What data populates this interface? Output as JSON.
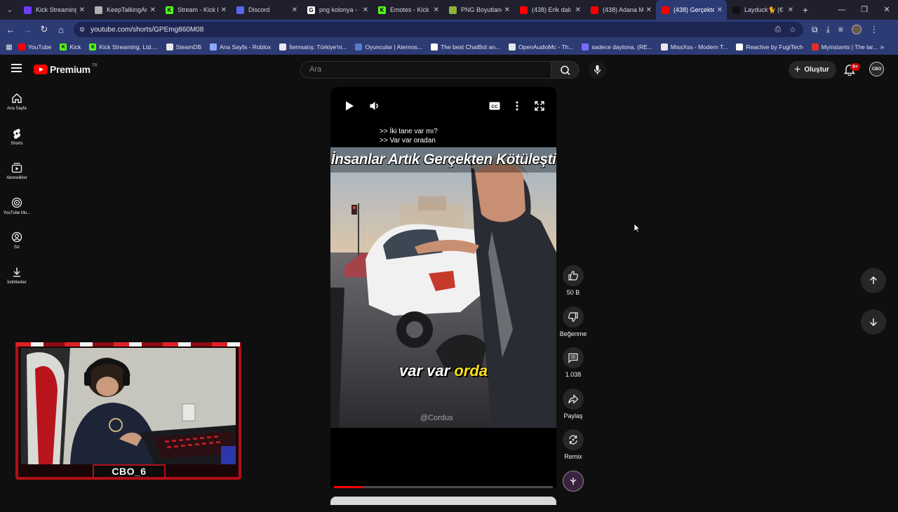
{
  "browser": {
    "tabs": [
      {
        "title": "Kick Streaming",
        "fav": "#6d3cf4",
        "fav_char": ""
      },
      {
        "title": "KeepTalkingAn",
        "fav": "#b0b0b0",
        "fav_char": ""
      },
      {
        "title": "Stream - Kick D",
        "fav": "#53fc18",
        "fav_char": "K"
      },
      {
        "title": "Discord",
        "fav": "#5865f2",
        "fav_char": ""
      },
      {
        "title": "png kolonya -",
        "fav": "#ffffff",
        "fav_char": "G"
      },
      {
        "title": "Emotes - Kick D",
        "fav": "#53fc18",
        "fav_char": "K"
      },
      {
        "title": "PNG Boyutland",
        "fav": "#8fb33a",
        "fav_char": ""
      },
      {
        "title": "(438) Erik dalı",
        "fav": "#ff0000",
        "fav_char": ""
      },
      {
        "title": "(438) Adana M",
        "fav": "#ff0000",
        "fav_char": ""
      },
      {
        "title": "(438) Gerçekte",
        "fav": "#ff0000",
        "fav_char": "",
        "active": true
      },
      {
        "title": "Layduck🐈 (€",
        "fav": "#111111",
        "fav_char": ""
      }
    ],
    "url": "youtube.com/shorts/GPEmg860M08",
    "bookmarks": [
      {
        "label": "YouTube",
        "fav": "#ff0000",
        "fav_char": ""
      },
      {
        "label": "Kick",
        "fav": "#53fc18",
        "fav_char": "K"
      },
      {
        "label": "Kick Streaming, Ltd....",
        "fav": "#53fc18",
        "fav_char": "K"
      },
      {
        "label": "SteamDB",
        "fav": "#e8e8e8",
        "fav_char": ""
      },
      {
        "label": "Ana Sayfa - Roblox",
        "fav": "#8fa8ff",
        "fav_char": ""
      },
      {
        "label": "İtemsatış: Türkiye'ni...",
        "fav": "#e8e8e8",
        "fav_char": ""
      },
      {
        "label": "Oyuncular | Aternos...",
        "fav": "#5a7ad0",
        "fav_char": ""
      },
      {
        "label": "The best ChatBot an...",
        "fav": "#ffffff",
        "fav_char": ""
      },
      {
        "label": "OpenAudioMc - Th...",
        "fav": "#e8e8e8",
        "fav_char": ""
      },
      {
        "label": "sadece daytona. (RE...",
        "fav": "#7a6bff",
        "fav_char": ""
      },
      {
        "label": "MissXss - Modern T...",
        "fav": "#e8e8e8",
        "fav_char": ""
      },
      {
        "label": "Reactive by FugiTech",
        "fav": "#ffffff",
        "fav_char": ""
      },
      {
        "label": "Myinstants | The lar...",
        "fav": "#e0302a",
        "fav_char": ""
      }
    ]
  },
  "header": {
    "brand": "Premium",
    "region": "TR",
    "search_placeholder": "Ara",
    "create_label": "Oluştur",
    "notif_count": "9+",
    "avatar_text": "CBO"
  },
  "guide": [
    {
      "label": "Ana Sayfa",
      "icon": "home-icon"
    },
    {
      "label": "Shorts",
      "icon": "shorts-icon"
    },
    {
      "label": "Abonelikler",
      "icon": "subscriptions-icon"
    },
    {
      "label": "YouTube Mu...",
      "icon": "music-icon"
    },
    {
      "label": "Siz",
      "icon": "you-icon"
    },
    {
      "label": "İndirilenler",
      "icon": "download-icon"
    }
  ],
  "short": {
    "subtitle_lines": [
      ">> İki tane var mı?",
      ">> Var var oradan"
    ],
    "headline": "İnsanlar Artık Gerçekten Kötüleşti",
    "caption_white": "var var",
    "caption_yellow": "orda",
    "watermark": "@Cordus",
    "progress": 0.13
  },
  "actions": {
    "likes": "50 B",
    "dislike_label": "Beğenme",
    "comments": "1.038",
    "share_label": "Paylaş",
    "remix_label": "Remix"
  },
  "webcam": {
    "name": "CBO_6"
  }
}
